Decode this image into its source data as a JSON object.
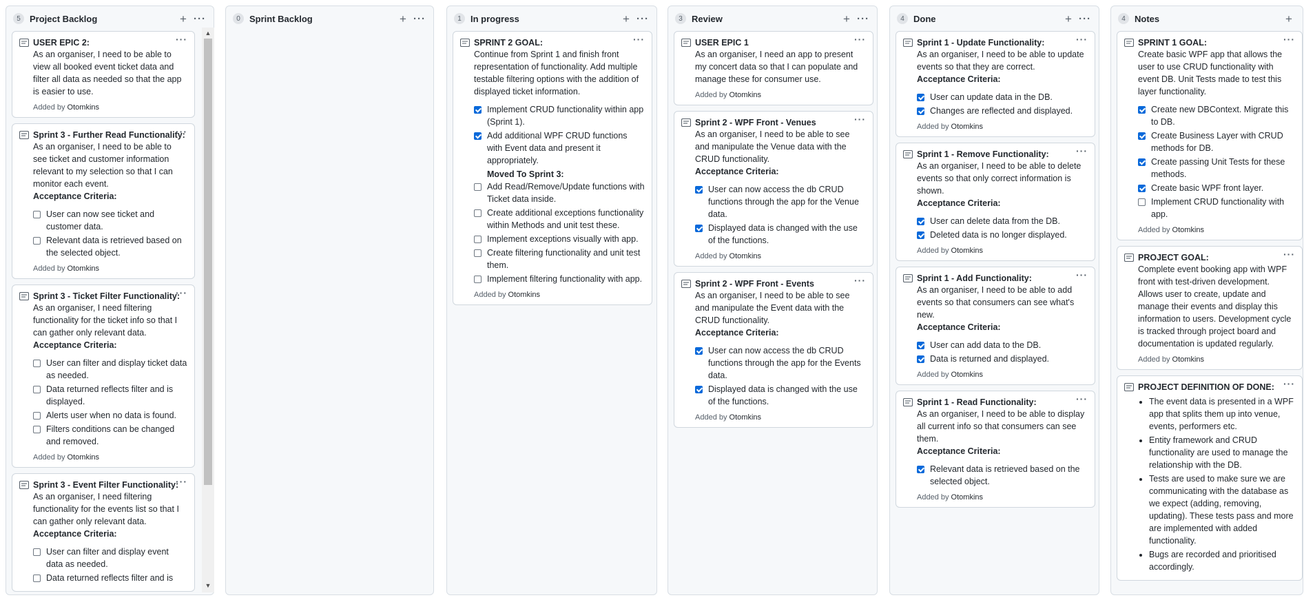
{
  "colors": {
    "accent": "#0969da",
    "column_bg": "#f6f8fa",
    "border": "#d0d7de"
  },
  "icons": {
    "card": "note-icon",
    "add": "plus-icon",
    "more": "kebab-icon"
  },
  "columns": [
    {
      "count": "5",
      "title": "Project Backlog",
      "plus": "+",
      "dots": "···",
      "cards": [
        {
          "title": "USER EPIC 2:",
          "dots": "···",
          "lines": [
            "As an organiser, I need to be able to view all booked event ticket data and filter all data as needed so that the app is easier to use."
          ],
          "added_prefix": "Added by ",
          "author": "Otomkins"
        },
        {
          "title": "Sprint 3 - Further Read Functionality:",
          "dots": "···",
          "lines": [
            "As an organiser, I need to be able to see ticket and customer information relevant to my selection so that I can monitor each event."
          ],
          "ac": "Acceptance Criteria:",
          "checks": [
            {
              "on": false,
              "text": "User can now see ticket and customer data."
            },
            {
              "on": false,
              "text": "Relevant data is retrieved based on the selected object."
            }
          ],
          "added_prefix": "Added by ",
          "author": "Otomkins"
        },
        {
          "title": "Sprint 3 - Ticket Filter Functionality:",
          "dots": "···",
          "lines": [
            "As an organiser, I need filtering functionality for the ticket info so that I can gather only relevant data."
          ],
          "ac": "Acceptance Criteria:",
          "checks": [
            {
              "on": false,
              "text": "User can filter and display ticket data as needed."
            },
            {
              "on": false,
              "text": "Data returned reflects filter and is displayed."
            },
            {
              "on": false,
              "text": "Alerts user when no data is found."
            },
            {
              "on": false,
              "text": "Filters conditions can be changed and removed."
            }
          ],
          "added_prefix": "Added by ",
          "author": "Otomkins"
        },
        {
          "title": "Sprint 3 - Event Filter Functionality:",
          "dots": "···",
          "lines": [
            "As an organiser, I need filtering functionality for the events list so that I can gather only relevant data."
          ],
          "ac": "Acceptance Criteria:",
          "checks": [
            {
              "on": false,
              "text": "User can filter and display event data as needed."
            },
            {
              "on": false,
              "text": "Data returned reflects filter and is"
            }
          ]
        }
      ]
    },
    {
      "count": "0",
      "title": "Sprint Backlog",
      "plus": "+",
      "dots": "···",
      "cards": []
    },
    {
      "count": "1",
      "title": "In progress",
      "plus": "+",
      "dots": "···",
      "cards": [
        {
          "title": "SPRINT 2 GOAL:",
          "dots": "···",
          "lines": [
            "Continue from Sprint 1 and finish front representation of functionality. Add multiple testable filtering options with the addition of displayed ticket information."
          ],
          "checks": [
            {
              "on": true,
              "text": "Implement CRUD functionality within app (Sprint 1)."
            },
            {
              "on": true,
              "text": "Add additional WPF CRUD functions with Event data and present it appropriately."
            }
          ],
          "subhead": "Moved To Sprint 3:",
          "checks2": [
            {
              "on": false,
              "text": "Add Read/Remove/Update functions with Ticket data inside."
            },
            {
              "on": false,
              "text": "Create additional exceptions functionality within Methods and unit test these."
            },
            {
              "on": false,
              "text": "Implement exceptions visually with app."
            },
            {
              "on": false,
              "text": "Create filtering functionality and unit test them."
            },
            {
              "on": false,
              "text": "Implement filtering functionality with app."
            }
          ],
          "added_prefix": "Added by ",
          "author": "Otomkins"
        }
      ]
    },
    {
      "count": "3",
      "title": "Review",
      "plus": "+",
      "dots": "···",
      "cards": [
        {
          "title": "USER EPIC 1",
          "dots": "···",
          "lines": [
            "As an organiser, I need an app to present my concert data so that I can populate and manage these for consumer use."
          ],
          "added_prefix": "Added by ",
          "author": "Otomkins"
        },
        {
          "title": "Sprint 2 - WPF Front - Venues",
          "dots": "···",
          "lines": [
            "As an organiser, I need to be able to see and manipulate the Venue data with the CRUD functionality."
          ],
          "ac": "Acceptance Criteria:",
          "checks": [
            {
              "on": true,
              "text": "User can now access the db CRUD functions through the app for the Venue data."
            },
            {
              "on": true,
              "text": "Displayed data is changed with the use of the functions."
            }
          ],
          "added_prefix": "Added by ",
          "author": "Otomkins"
        },
        {
          "title": "Sprint 2 - WPF Front - Events",
          "dots": "···",
          "lines": [
            "As an organiser, I need to be able to see and manipulate the Event data with the CRUD functionality."
          ],
          "ac": "Acceptance Criteria:",
          "checks": [
            {
              "on": true,
              "text": "User can now access the db CRUD functions through the app for the Events data."
            },
            {
              "on": true,
              "text": "Displayed data is changed with the use of the functions."
            }
          ],
          "added_prefix": "Added by ",
          "author": "Otomkins"
        }
      ]
    },
    {
      "count": "4",
      "title": "Done",
      "plus": "+",
      "dots": "···",
      "cards": [
        {
          "title": "Sprint 1 - Update Functionality:",
          "dots": "···",
          "lines": [
            "As an organiser, I need to be able to update events so that they are correct."
          ],
          "ac": "Acceptance Criteria:",
          "checks": [
            {
              "on": true,
              "text": "User can update data in the DB."
            },
            {
              "on": true,
              "text": "Changes are reflected and displayed."
            }
          ],
          "added_prefix": "Added by ",
          "author": "Otomkins"
        },
        {
          "title": "Sprint 1 - Remove Functionality:",
          "dots": "···",
          "lines": [
            "As an organiser, I need to be able to delete events so that only correct information is shown."
          ],
          "ac": "Acceptance Criteria:",
          "checks": [
            {
              "on": true,
              "text": "User can delete data from the DB."
            },
            {
              "on": true,
              "text": "Deleted data is no longer displayed."
            }
          ],
          "added_prefix": "Added by ",
          "author": "Otomkins"
        },
        {
          "title": "Sprint 1 - Add Functionality:",
          "dots": "···",
          "lines": [
            "As an organiser, I need to be able to add events so that consumers can see what's new."
          ],
          "ac": "Acceptance Criteria:",
          "checks": [
            {
              "on": true,
              "text": "User can add data to the DB."
            },
            {
              "on": true,
              "text": "Data is returned and displayed."
            }
          ],
          "added_prefix": "Added by ",
          "author": "Otomkins"
        },
        {
          "title": "Sprint 1 - Read Functionality:",
          "dots": "···",
          "lines": [
            "As an organiser, I need to be able to display all current info so that consumers can see them."
          ],
          "ac": "Acceptance Criteria:",
          "checks": [
            {
              "on": true,
              "text": "Relevant data is retrieved based on the selected object."
            }
          ],
          "added_prefix": "Added by ",
          "author": "Otomkins"
        }
      ]
    },
    {
      "count": "4",
      "title": "Notes",
      "plus": "+",
      "dots": "",
      "cards": [
        {
          "title": "SPRINT 1 GOAL:",
          "dots": "···",
          "lines": [
            "Create basic WPF app that allows the user to use CRUD functionality with event DB. Unit Tests made to test this layer functionality."
          ],
          "checks": [
            {
              "on": true,
              "text": "Create new DBContext. Migrate this to DB."
            },
            {
              "on": true,
              "text": "Create Business Layer with CRUD methods for DB."
            },
            {
              "on": true,
              "text": "Create passing Unit Tests for these methods."
            },
            {
              "on": true,
              "text": "Create basic WPF front layer."
            },
            {
              "on": false,
              "text": "Implement CRUD functionality with app."
            }
          ],
          "added_prefix": "Added by ",
          "author": "Otomkins"
        },
        {
          "title": "PROJECT GOAL:",
          "dots": "···",
          "lines": [
            "Complete event booking app with WPF front with test-driven development. Allows user to create, update and manage their events and display this information to users. Development cycle is tracked through project board and documentation is updated regularly."
          ],
          "added_prefix": "Added by ",
          "author": "Otomkins"
        },
        {
          "title": "PROJECT DEFINITION OF DONE:",
          "dots": "···",
          "bullets": [
            "The event data is presented in a WPF app that splits them up into venue, events, performers etc.",
            "Entity framework and CRUD functionality are used to manage the relationship with the DB.",
            "Tests are used to make sure we are communicating with the database as we expect (adding, removing, updating). These tests pass and more are implemented with added functionality.",
            "Bugs are recorded and prioritised accordingly."
          ]
        }
      ]
    }
  ],
  "scrollbar": {
    "up": "▲",
    "down": "▼"
  }
}
